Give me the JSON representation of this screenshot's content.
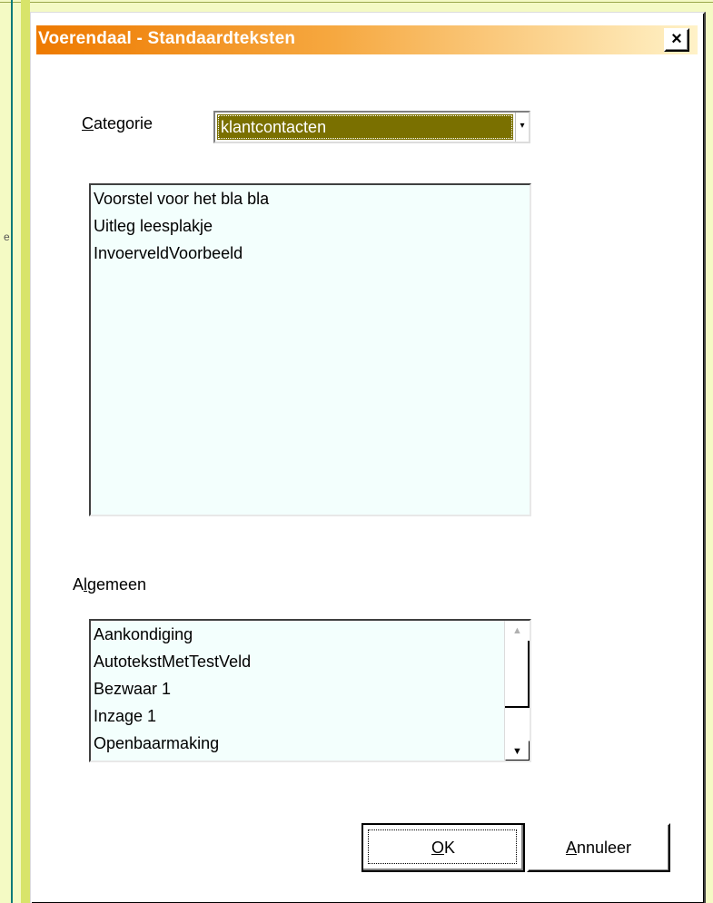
{
  "window": {
    "title": "Voerendaal - Standaardteksten",
    "close_label": "×"
  },
  "category": {
    "label_accel": "C",
    "label_rest": "ategorie",
    "selected_value": "klantcontacten",
    "dropdown_glyph": "▾"
  },
  "category_list": {
    "items": [
      "Voorstel voor het bla bla",
      "Uitleg leesplakje",
      "InvoerveldVoorbeeld"
    ]
  },
  "general": {
    "label_pre": "A",
    "label_accel": "l",
    "label_rest": "gemeen",
    "items": [
      "Aankondiging",
      "AutotekstMetTestVeld",
      "Bezwaar 1",
      "Inzage 1",
      "Openbaarmaking"
    ],
    "scroll_up_glyph": "▲",
    "scroll_down_glyph": "▼"
  },
  "buttons": {
    "ok_accel": "O",
    "ok_rest": "K",
    "cancel_accel": "A",
    "cancel_rest": "nnuleer"
  },
  "colors": {
    "title_gradient_start": "#ee7a00",
    "selection_bg": "#7a7000",
    "list_bg": "#f3fffd",
    "page_bg": "#f4fac4"
  },
  "background": {
    "edge_glyph": "e"
  }
}
